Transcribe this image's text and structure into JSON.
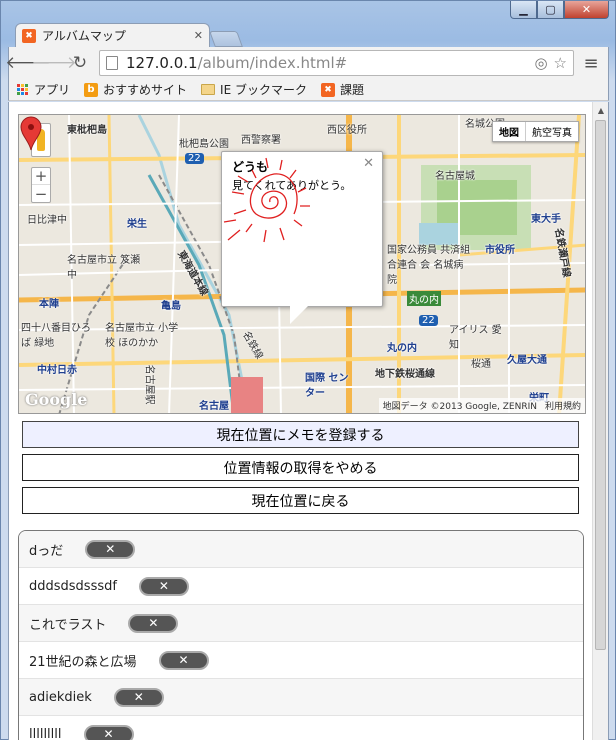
{
  "browser": {
    "tab_title": "アルバムマップ",
    "url_host": "127.0.0.1",
    "url_path": "/album/index.html#",
    "bookmarks": [
      "アプリ",
      "おすすめサイト",
      "IE ブックマーク",
      "課題"
    ]
  },
  "map": {
    "type_buttons": [
      "地図",
      "航空写真"
    ],
    "attribution": "地図データ ©2013 Google, ZENRIN",
    "terms": "利用規約",
    "logo": "Google",
    "labels": {
      "l1": "東枇杷島",
      "l2": "枇杷島公園",
      "l3": "西警察署",
      "l4": "西区役所",
      "l5": "名城公園",
      "l6": "日比津中",
      "l7": "栄生",
      "l8": "名古屋市立 笈瀬中",
      "l9": "本陣",
      "l10": "亀島",
      "l11": "四十八番目ひろば 緑地",
      "l12": "名古屋市立 小学校 ほのかか",
      "l13": "中村日赤",
      "l14": "名古屋城",
      "l15": "東大手",
      "l16": "市役所",
      "l17": "国家公務員 共済組合連合 会 名城病院",
      "l18": "丸の内",
      "l19": "アイリス 愛知",
      "l20": "久屋大通",
      "l21": "地下鉄桜通線",
      "l22": "栄町",
      "l23": "名古屋",
      "l24": "国際 センター",
      "l25": "東海道本線",
      "l26": "名鉄線",
      "l27": "桜通",
      "l28": "名鉄瀬戸線",
      "l29": "丸の内",
      "l30": "名古屋駅",
      "route22": "22"
    }
  },
  "infowindow": {
    "title": "どうも",
    "body": "見てくれてありがとう。"
  },
  "actions": {
    "register": "現在位置にメモを登録する",
    "stop": "位置情報の取得をやめる",
    "back": "現在位置に戻る"
  },
  "memos": [
    {
      "name": "dっだ",
      "delete": "✕"
    },
    {
      "name": "dddsdsdsssdf",
      "delete": "✕"
    },
    {
      "name": "これでラスト",
      "delete": "✕"
    },
    {
      "name": "21世紀の森と広場",
      "delete": "✕"
    },
    {
      "name": "adiekdiek",
      "delete": "✕"
    },
    {
      "name": "lllllllll",
      "delete": "✕"
    }
  ],
  "colors": {
    "accent_blue": "#1a73e8",
    "marker_red": "#e53935",
    "memo_delete_bg": "#555555"
  }
}
